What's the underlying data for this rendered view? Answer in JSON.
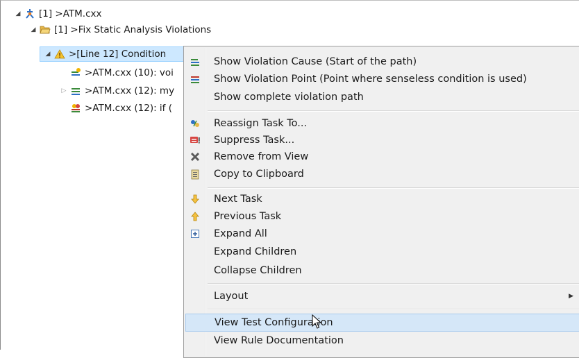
{
  "tree": {
    "rows": [
      {
        "label": "[1] >ATM.cxx",
        "icon": "run-icon",
        "twisty": "open"
      },
      {
        "label": "[1] >Fix Static Analysis Violations",
        "icon": "folder-open-icon",
        "twisty": "open"
      },
      {
        "label": ">[Line 12] Condition",
        "icon": "warning-icon",
        "twisty": "open"
      },
      {
        "label": ">ATM.cxx (10): voi",
        "icon": "flow-start-icon",
        "twisty": ""
      },
      {
        "label": ">ATM.cxx (12): my",
        "icon": "flow-path-icon",
        "twisty": "closed"
      },
      {
        "label": ">ATM.cxx (12): if (",
        "icon": "flow-end-icon",
        "twisty": ""
      }
    ]
  },
  "menu": {
    "items": [
      {
        "label": "Show Violation Cause (Start of the path)",
        "icon": "cause-icon"
      },
      {
        "label": "Show Violation Point (Point where senseless condition is used)",
        "icon": "point-icon"
      },
      {
        "label": "Show complete violation path",
        "icon": ""
      },
      {
        "label": "Reassign Task To...",
        "icon": "reassign-icon"
      },
      {
        "label": "Suppress Task...",
        "icon": "suppress-icon"
      },
      {
        "label": "Remove from View",
        "icon": "remove-x-icon"
      },
      {
        "label": "Copy to Clipboard",
        "icon": "clipboard-icon"
      },
      {
        "label": "Next Task",
        "icon": "arrow-down-icon"
      },
      {
        "label": "Previous Task",
        "icon": "arrow-up-icon"
      },
      {
        "label": "Expand All",
        "icon": "expand-all-icon"
      },
      {
        "label": "Expand Children",
        "icon": ""
      },
      {
        "label": "Collapse Children",
        "icon": ""
      },
      {
        "label": "Layout",
        "icon": ""
      },
      {
        "label": "View Test Configuration",
        "icon": ""
      },
      {
        "label": "View Rule Documentation",
        "icon": ""
      }
    ]
  },
  "colors": {
    "selection_bg": "#cde8ff",
    "menu_hover_bg": "#d5e7f8",
    "menu_bg": "#f0f0f0"
  }
}
